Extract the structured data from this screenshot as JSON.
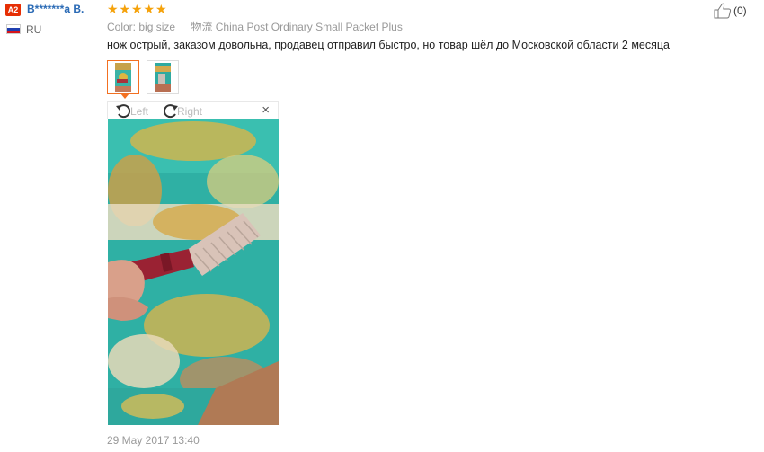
{
  "user": {
    "level": "A2",
    "name": "B*******a B.",
    "country": "RU"
  },
  "review": {
    "rating": 5,
    "stars": [
      "★",
      "★",
      "★",
      "★",
      "★"
    ],
    "color_label": "Color:",
    "color_value": "big size",
    "shipping_label": "物流",
    "shipping_value": "China Post Ordinary Small Packet Plus",
    "text": "нож острый, заказом довольна, продавец отправил быстро, но товар шёл до Московской области 2 месяца",
    "date": "29 May 2017 13:40"
  },
  "likes": {
    "count": "(0)",
    "icon": "thumbs-up-icon"
  },
  "viewer": {
    "rotate_left": "Left",
    "rotate_right": "Right",
    "close": "×"
  },
  "colors": {
    "accent": "#f37021",
    "user_link": "#2a6ab5",
    "star": "#f5a20b",
    "badge": "#e62e04"
  }
}
